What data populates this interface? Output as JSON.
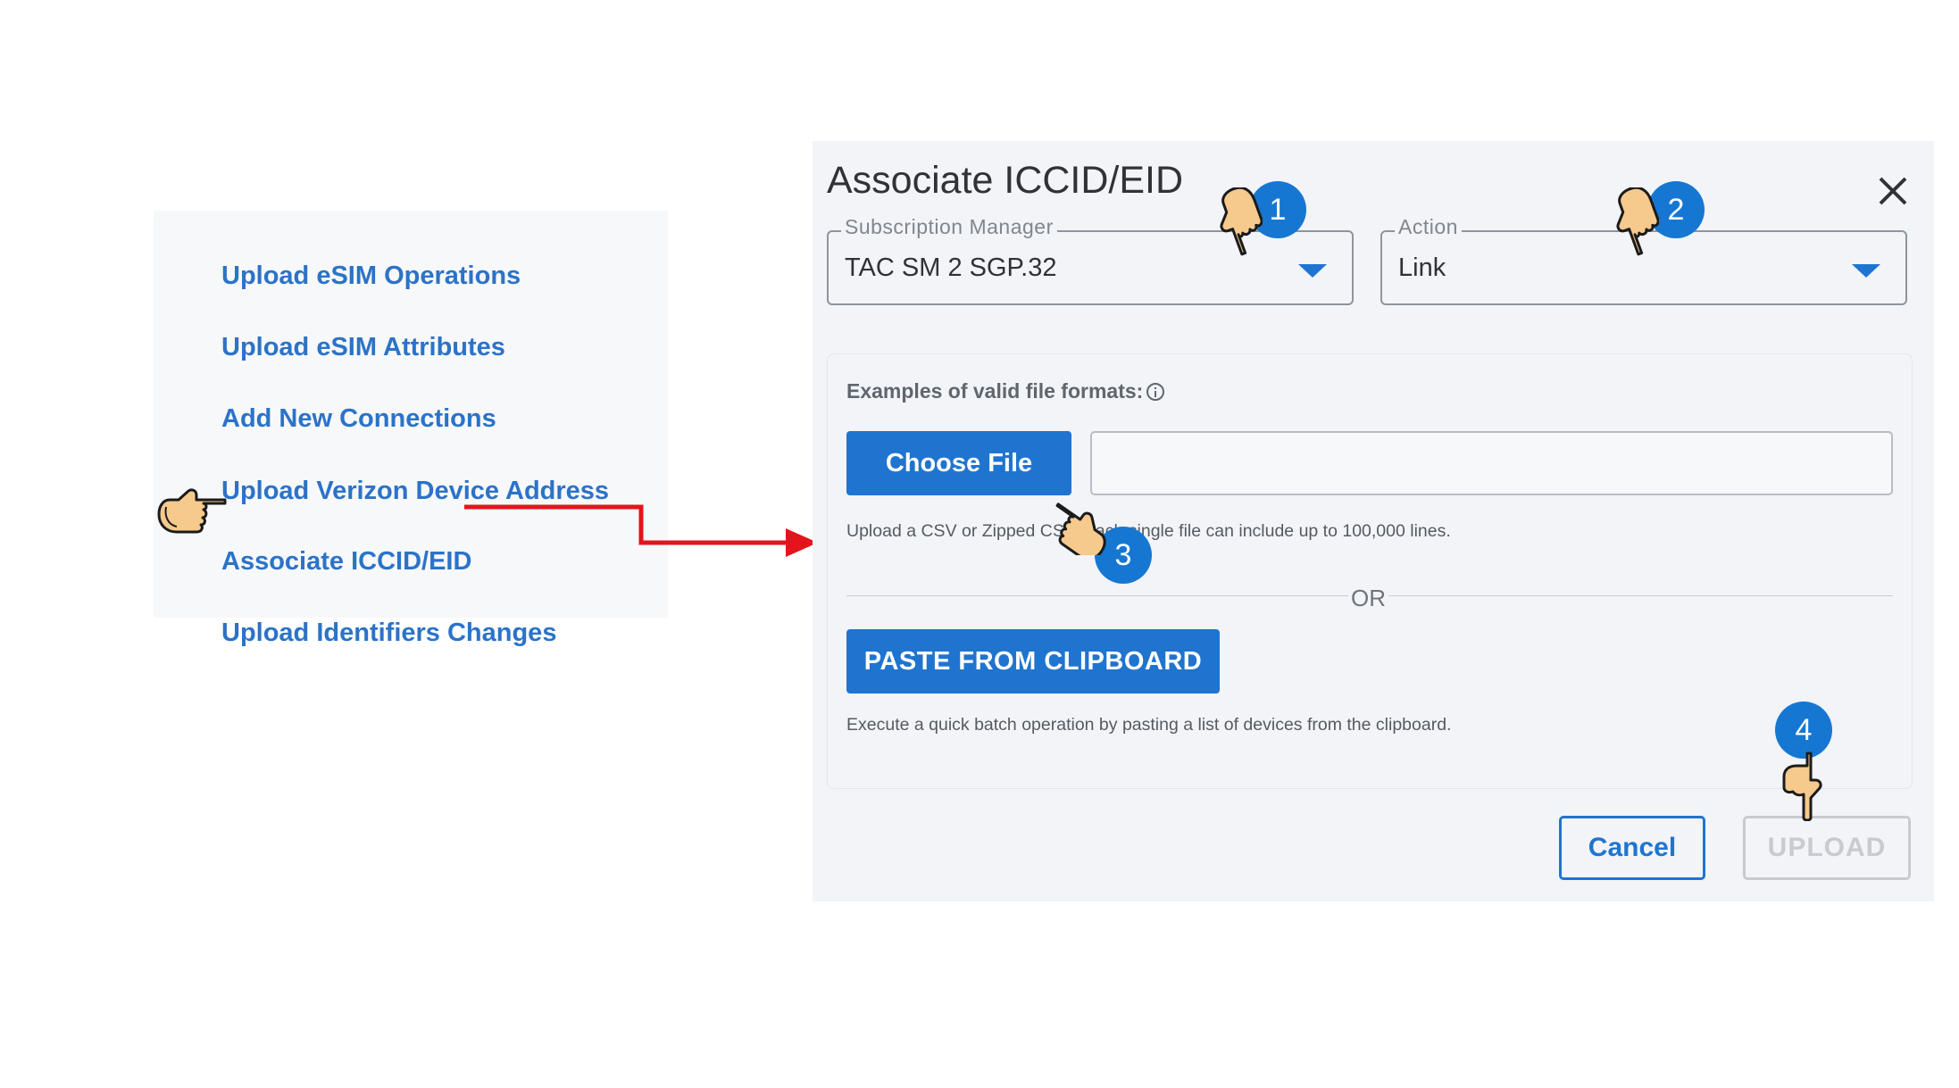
{
  "menu": {
    "items": [
      {
        "label": "Upload eSIM Operations"
      },
      {
        "label": "Upload eSIM Attributes"
      },
      {
        "label": "Add New Connections"
      },
      {
        "label": "Upload Verizon Device Address"
      },
      {
        "label": "Associate ICCID/EID"
      },
      {
        "label": "Upload Identifiers Changes"
      }
    ]
  },
  "dialog": {
    "title": "Associate ICCID/EID",
    "subscription_manager": {
      "label": "Subscription Manager",
      "value": "TAC SM 2 SGP.32"
    },
    "action": {
      "label": "Action",
      "value": "Link"
    },
    "formats_hint": "Examples of valid file formats:",
    "choose_file_label": "Choose File",
    "file_input_value": "",
    "upload_hint": "Upload a CSV or Zipped CSV. Each single file can include up to 100,000 lines.",
    "or_label": "OR",
    "paste_label": "PASTE FROM CLIPBOARD",
    "paste_hint": "Execute a quick batch operation by pasting a list of devices from the clipboard.",
    "cancel_label": "Cancel",
    "upload_label": "UPLOAD"
  },
  "steps": [
    "1",
    "2",
    "3",
    "4"
  ],
  "colors": {
    "link_blue": "#2b73c8",
    "primary": "#1f74d0",
    "badge": "#1677d2",
    "arrow_red": "#e3141b",
    "disabled": "#c7cbd0"
  },
  "icons": [
    "pointing-hand-icon",
    "close-icon",
    "info-icon",
    "chevron-down-icon",
    "red-arrow-icon"
  ]
}
